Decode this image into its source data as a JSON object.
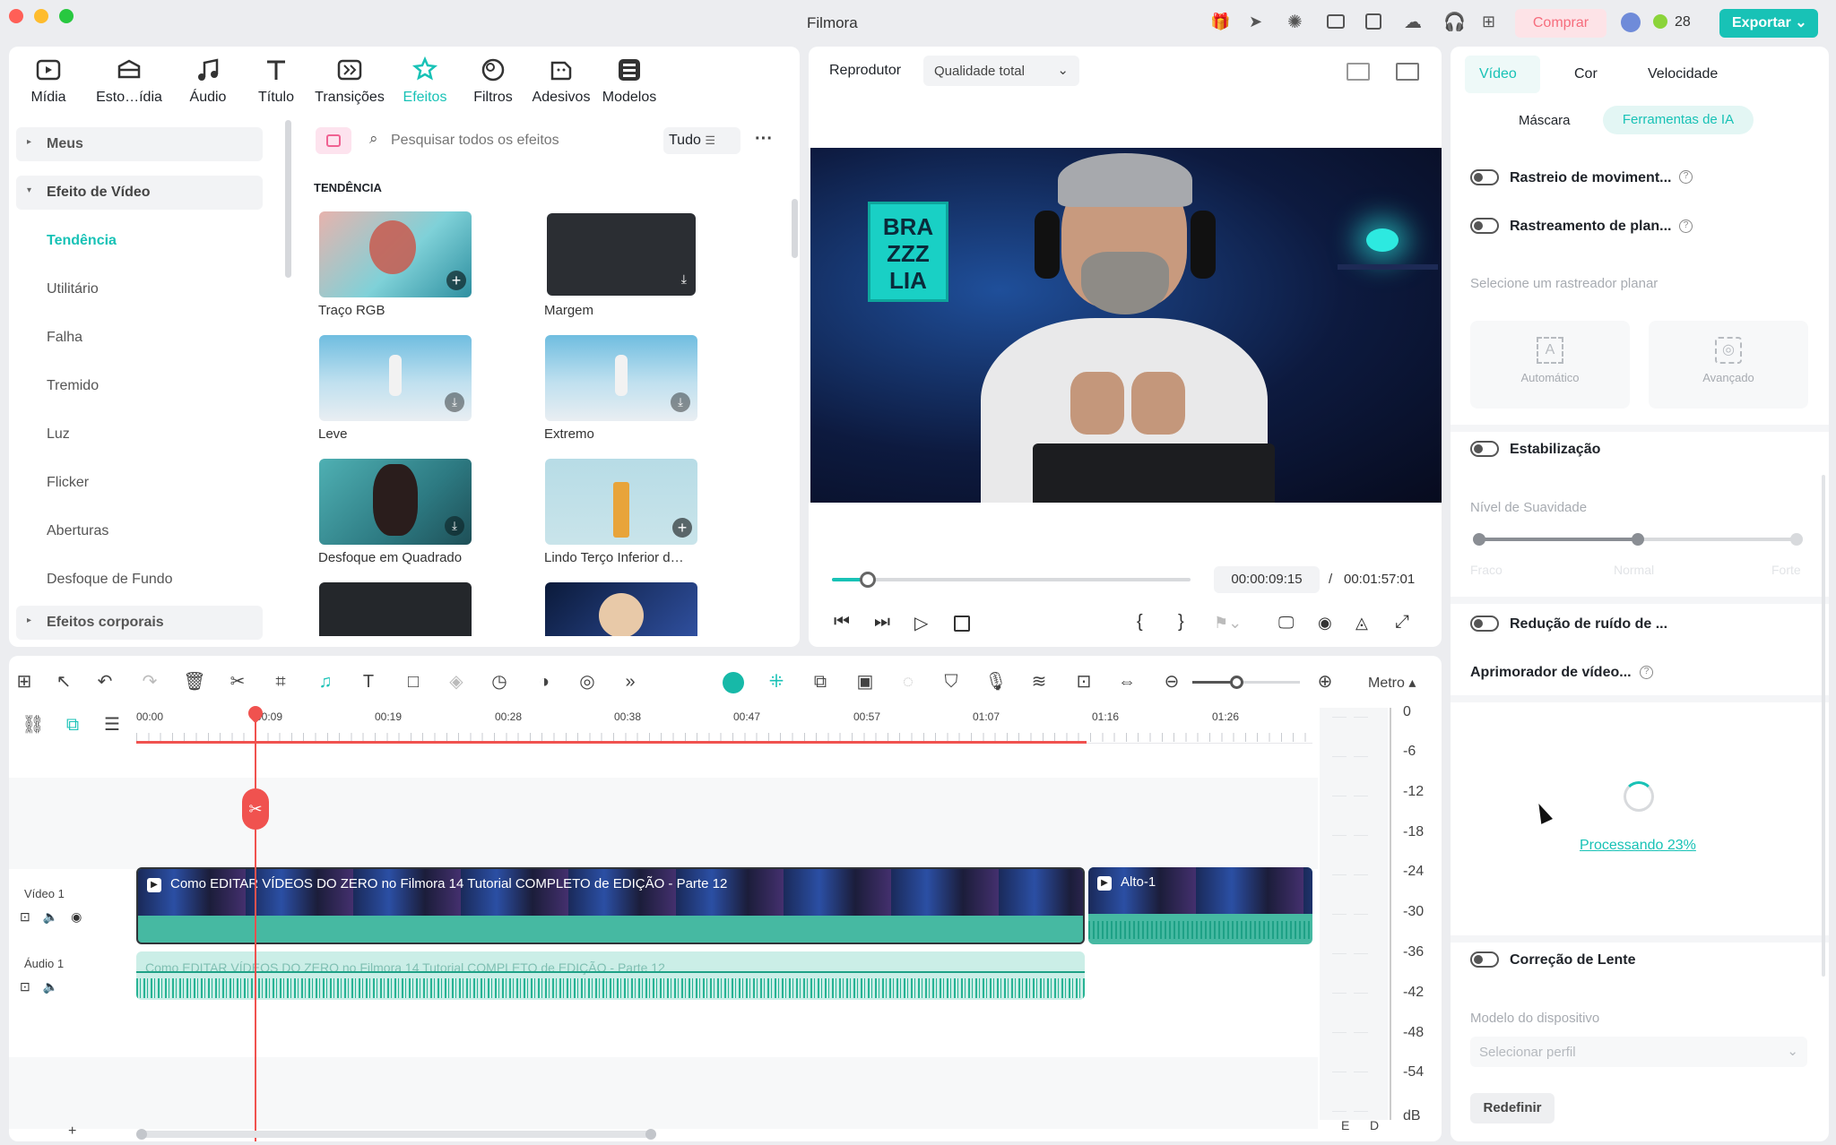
{
  "app": {
    "title": "Filmora"
  },
  "header": {
    "buy_label": "Comprar",
    "credits": "28",
    "export_label": "Exportar"
  },
  "media_tabs": [
    {
      "label": "Mídia",
      "icon": "media-icon"
    },
    {
      "label": "Esto…ídia",
      "icon": "stock-media-icon"
    },
    {
      "label": "Áudio",
      "icon": "music-note-icon"
    },
    {
      "label": "Título",
      "icon": "title-t-icon"
    },
    {
      "label": "Transições",
      "icon": "transitions-icon"
    },
    {
      "label": "Efeitos",
      "icon": "effects-icon"
    },
    {
      "label": "Filtros",
      "icon": "filters-icon"
    },
    {
      "label": "Adesivos",
      "icon": "stickers-icon"
    },
    {
      "label": "Modelos",
      "icon": "templates-icon"
    }
  ],
  "sidebar": {
    "group_mine": "Meus",
    "group_video": "Efeito de Vídeo",
    "items": [
      "Tendência",
      "Utilitário",
      "Falha",
      "Tremido",
      "Luz",
      "Flicker",
      "Aberturas",
      "Desfoque de Fundo"
    ],
    "group_body": "Efeitos corporais"
  },
  "effects": {
    "search_placeholder": "Pesquisar todos os efeitos",
    "filter_label": "Tudo",
    "section_title": "TENDÊNCIA",
    "tiles": [
      "Traço RGB",
      "Margem",
      "Leve",
      "Extremo",
      "Desfoque em Quadrado",
      "Lindo Terço Inferior d…"
    ]
  },
  "player": {
    "label": "Reprodutor",
    "quality": "Qualidade total",
    "current_time": "00:00:09:15",
    "separator": "/",
    "total_time": "00:01:57:01",
    "progress": 0.1,
    "poster_text": "BRA ZZZ LIA"
  },
  "timeline": {
    "ruler": [
      "00:00",
      "00:09",
      "00:19",
      "00:28",
      "00:38",
      "00:47",
      "00:57",
      "01:07",
      "01:16",
      "01:26"
    ],
    "meter_label": "Metro",
    "video_track": "Vídeo 1",
    "audio_track": "Áudio 1",
    "clip_title": "Como EDITAR VÍDEOS DO ZERO no Filmora 14  Tutorial COMPLETO de EDIÇÃO - Parte 12",
    "clip2_title": "Alto-1",
    "audio_clip_title": "Como EDITAR VÍDEOS DO ZERO no Filmora 14  Tutorial COMPLETO de EDIÇÃO - Parte 12",
    "db_scale": [
      "0",
      "-6",
      "-12",
      "-18",
      "-24",
      "-30",
      "-36",
      "-42",
      "-48",
      "-54",
      "dB"
    ],
    "channels": [
      "E",
      "D"
    ],
    "add_track": "+"
  },
  "right_panel": {
    "tabs": [
      "Vídeo",
      "Cor",
      "Velocidade"
    ],
    "subtabs": [
      "Máscara",
      "Ferramentas de IA"
    ],
    "motion_tracking": "Rastreio de moviment...",
    "planar_tracking": "Rastreamento de plan...",
    "planar_hint": "Selecione um rastreador planar",
    "auto_label": "Automático",
    "advanced_label": "Avançado",
    "stabilization": "Estabilização",
    "smoothness": "Nível de Suavidade",
    "smooth_levels": [
      "Fraco",
      "Normal",
      "Forte"
    ],
    "smooth_value": 0.5,
    "noise_reduction": "Redução de ruído de ...",
    "enhancer": "Aprimorador de vídeo...",
    "processing": "Processando 23%",
    "lens_correction": "Correção de Lente",
    "device_model": "Modelo do dispositivo",
    "profile_placeholder": "Selecionar perfil",
    "reset_label": "Redefinir"
  },
  "colors": {
    "accent": "#18c2b6",
    "playhead": "#f0524f",
    "clip": "#46b9a2",
    "buy": "#f66d7d"
  }
}
